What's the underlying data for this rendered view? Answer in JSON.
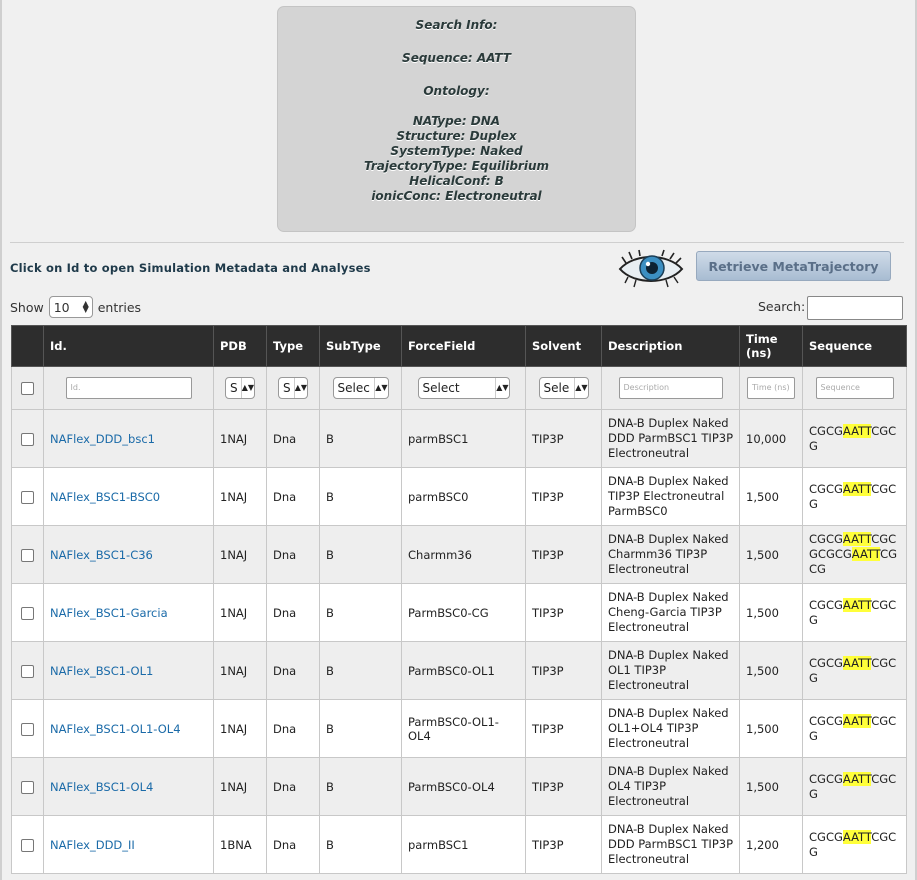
{
  "search_info": {
    "title": "Search Info:",
    "sequence": "Sequence: AATT",
    "ontology": "Ontology:",
    "natype": "NAType: DNA",
    "structure": "Structure: Duplex",
    "systemtype": "SystemType: Naked",
    "trajectorytype": "TrajectoryType: Equilibrium",
    "helicalconf": "HelicalConf: B",
    "ionicconc": "ionicConc: Electroneutral"
  },
  "note": "Click on Id to open Simulation Metadata and Analyses",
  "logo_icon": "eye-icon",
  "retrieve_button": "Retrieve MetaTrajectory",
  "length": {
    "show": "Show",
    "value": "10",
    "entries": "entries"
  },
  "search": {
    "label": "Search:",
    "value": ""
  },
  "columns": [
    "Id.",
    "PDB",
    "Type",
    "SubType",
    "ForceField",
    "Solvent",
    "Description",
    "Time (ns)",
    "Sequence"
  ],
  "filters": {
    "id_placeholder": "Id.",
    "pdb": "S",
    "type": "S",
    "subtype": "Selec",
    "forcefield": "Select",
    "solvent": "Sele",
    "description_placeholder": "Description",
    "time_placeholder": "Time (ns)",
    "sequence_placeholder": "Sequence"
  },
  "colors": {
    "header_bg": "#2d2d2d",
    "link": "#1a6aa8",
    "highlight": "#ffff3a",
    "button_bg": "#bccbdd"
  },
  "rows": [
    {
      "id": "NAFlex_DDD_bsc1",
      "pdb": "1NAJ",
      "type": "Dna",
      "subtype": "B",
      "forcefield": "parmBSC1",
      "solvent": "TIP3P",
      "description": "DNA-B Duplex Naked DDD ParmBSC1 TIP3P Electroneutral",
      "time": "10,000",
      "seq_pre": "CGCG",
      "seq_hl": "AATT",
      "seq_post": "CGCG",
      "seq_pre2": "",
      "seq_hl2": "",
      "seq_post2": ""
    },
    {
      "id": "NAFlex_BSC1-BSC0",
      "pdb": "1NAJ",
      "type": "Dna",
      "subtype": "B",
      "forcefield": "parmBSC0",
      "solvent": "TIP3P",
      "description": "DNA-B Duplex Naked TIP3P Electroneutral ParmBSC0",
      "time": "1,500",
      "seq_pre": "CGCG",
      "seq_hl": "AATT",
      "seq_post": "CGCG",
      "seq_pre2": "",
      "seq_hl2": "",
      "seq_post2": ""
    },
    {
      "id": "NAFlex_BSC1-C36",
      "pdb": "1NAJ",
      "type": "Dna",
      "subtype": "B",
      "forcefield": "Charmm36",
      "solvent": "TIP3P",
      "description": "DNA-B Duplex Naked Charmm36 TIP3P Electroneutral",
      "time": "1,500",
      "seq_pre": "CGCG",
      "seq_hl": "AATT",
      "seq_post": "CGC",
      "seq_pre2": "GCGCG",
      "seq_hl2": "AATT",
      "seq_post2": "CGCG"
    },
    {
      "id": "NAFlex_BSC1-Garcia",
      "pdb": "1NAJ",
      "type": "Dna",
      "subtype": "B",
      "forcefield": "ParmBSC0-CG",
      "solvent": "TIP3P",
      "description": "DNA-B Duplex Naked Cheng-Garcia TIP3P Electroneutral",
      "time": "1,500",
      "seq_pre": "CGCG",
      "seq_hl": "AATT",
      "seq_post": "CGCG",
      "seq_pre2": "",
      "seq_hl2": "",
      "seq_post2": ""
    },
    {
      "id": "NAFlex_BSC1-OL1",
      "pdb": "1NAJ",
      "type": "Dna",
      "subtype": "B",
      "forcefield": "ParmBSC0-OL1",
      "solvent": "TIP3P",
      "description": "DNA-B Duplex Naked OL1 TIP3P Electroneutral",
      "time": "1,500",
      "seq_pre": "CGCG",
      "seq_hl": "AATT",
      "seq_post": "CGCG",
      "seq_pre2": "",
      "seq_hl2": "",
      "seq_post2": ""
    },
    {
      "id": "NAFlex_BSC1-OL1-OL4",
      "pdb": "1NAJ",
      "type": "Dna",
      "subtype": "B",
      "forcefield": "ParmBSC0-OL1-OL4",
      "solvent": "TIP3P",
      "description": "DNA-B Duplex Naked OL1+OL4 TIP3P Electroneutral",
      "time": "1,500",
      "seq_pre": "CGCG",
      "seq_hl": "AATT",
      "seq_post": "CGCG",
      "seq_pre2": "",
      "seq_hl2": "",
      "seq_post2": ""
    },
    {
      "id": "NAFlex_BSC1-OL4",
      "pdb": "1NAJ",
      "type": "Dna",
      "subtype": "B",
      "forcefield": "ParmBSC0-OL4",
      "solvent": "TIP3P",
      "description": "DNA-B Duplex Naked OL4 TIP3P Electroneutral",
      "time": "1,500",
      "seq_pre": "CGCG",
      "seq_hl": "AATT",
      "seq_post": "CGCG",
      "seq_pre2": "",
      "seq_hl2": "",
      "seq_post2": ""
    },
    {
      "id": "NAFlex_DDD_II",
      "pdb": "1BNA",
      "type": "Dna",
      "subtype": "B",
      "forcefield": "parmBSC1",
      "solvent": "TIP3P",
      "description": "DNA-B Duplex Naked DDD ParmBSC1 TIP3P Electroneutral",
      "time": "1,200",
      "seq_pre": "CGCG",
      "seq_hl": "AATT",
      "seq_post": "CGCG",
      "seq_pre2": "",
      "seq_hl2": "",
      "seq_post2": ""
    }
  ]
}
